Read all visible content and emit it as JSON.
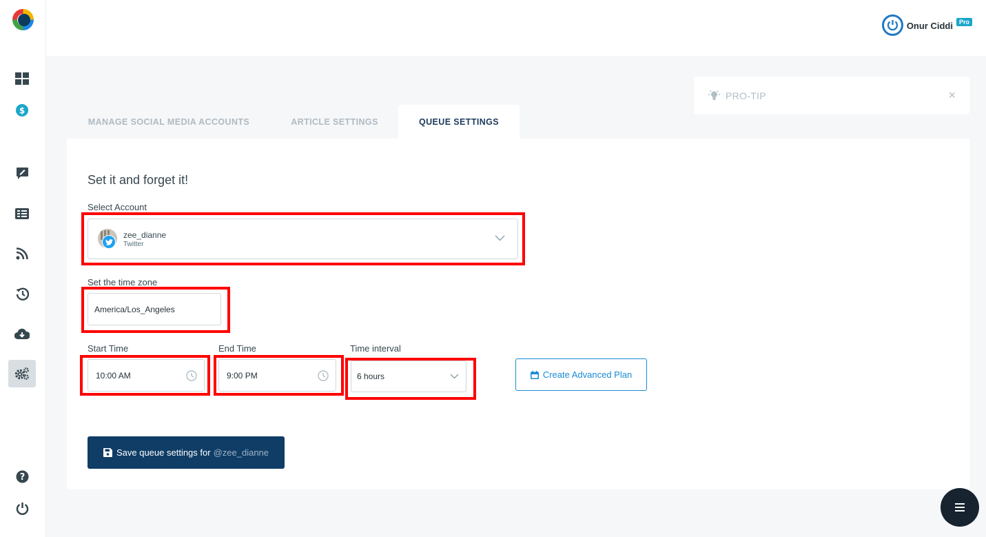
{
  "header": {
    "user_name": "Onur Ciddi",
    "badge": "Pro"
  },
  "sidebar": {
    "items": [
      {
        "icon": "dashboard-icon"
      },
      {
        "icon": "dollar-icon"
      },
      {
        "icon": "compose-icon"
      },
      {
        "icon": "article-list-icon"
      },
      {
        "icon": "rss-icon"
      },
      {
        "icon": "history-icon"
      },
      {
        "icon": "cloud-download-icon"
      },
      {
        "icon": "settings-gears-icon",
        "active": true
      },
      {
        "icon": "help-icon"
      },
      {
        "icon": "power-icon"
      }
    ]
  },
  "protip": {
    "label": "PRO-TIP",
    "close": "×"
  },
  "tabs": [
    {
      "label": "MANAGE SOCIAL MEDIA ACCOUNTS"
    },
    {
      "label": "ARTICLE SETTINGS"
    },
    {
      "label": "QUEUE SETTINGS",
      "active": true
    }
  ],
  "form": {
    "heading": "Set it and forget it!",
    "account_label": "Select Account",
    "account_name": "zee_dianne",
    "account_network": "Twitter",
    "timezone_label": "Set the time zone",
    "timezone_value": "America/Los_Angeles",
    "start_label": "Start Time",
    "start_value": "10:00 AM",
    "end_label": "End Time",
    "end_value": "9:00 PM",
    "interval_label": "Time interval",
    "interval_value": "6 hours",
    "advanced_button": "Create Advanced Plan",
    "save_button": "Save queue settings for",
    "save_handle": "@zee_dianne"
  },
  "colors": {
    "accent": "#1a8ad4",
    "primary_dark": "#0f3d66",
    "highlight": "#ff0000"
  }
}
